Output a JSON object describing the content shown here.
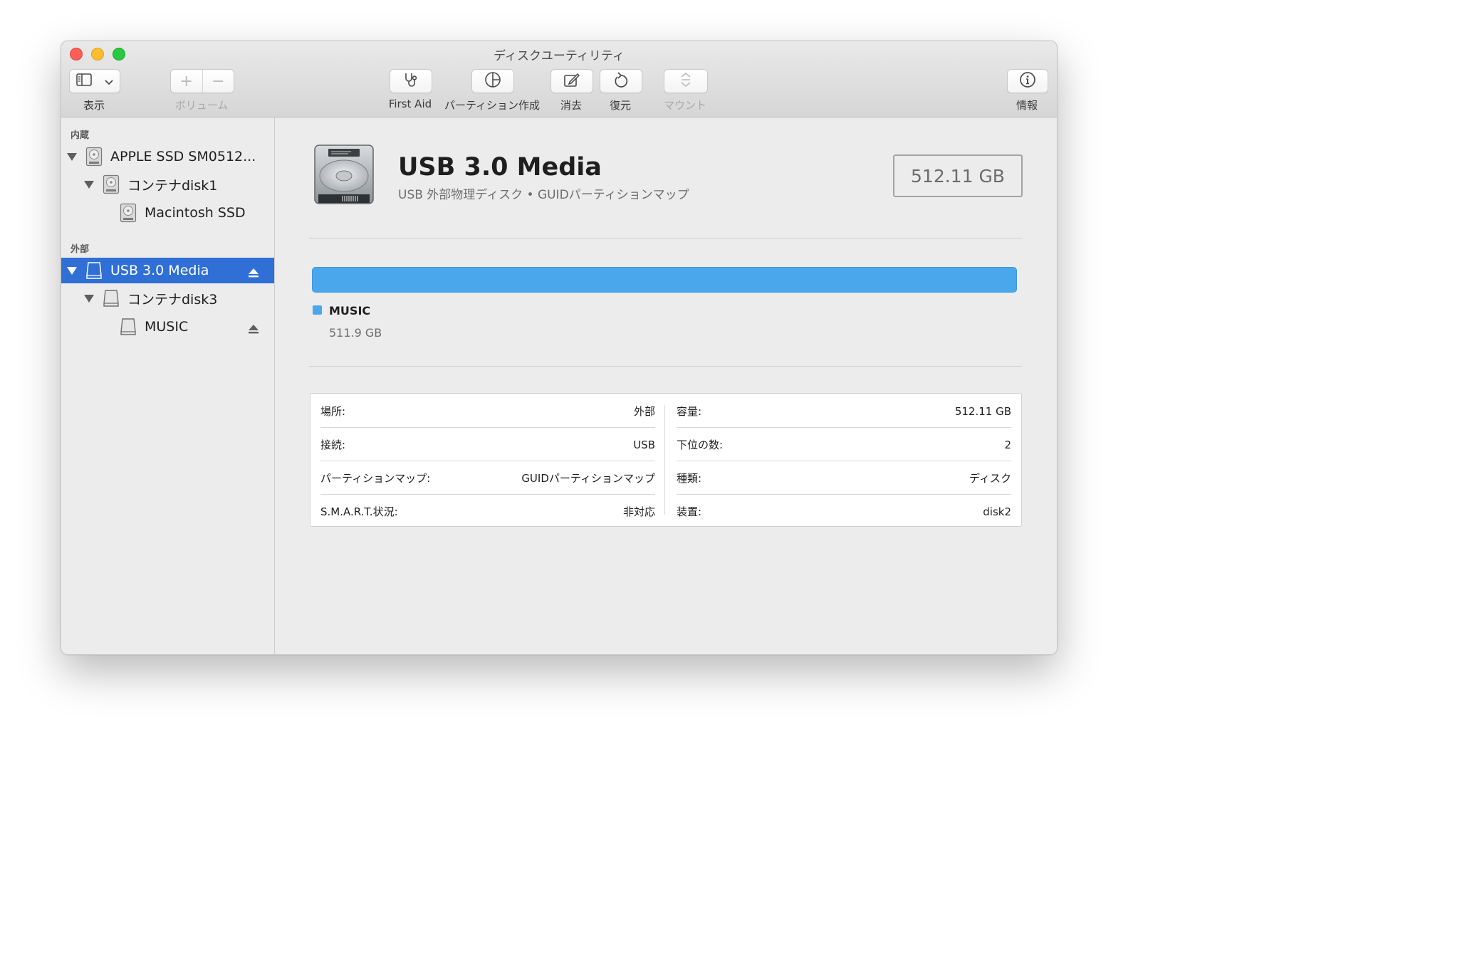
{
  "window": {
    "title": "ディスクユーティリティ"
  },
  "toolbar": {
    "view_label": "表示",
    "volume_label": "ボリューム",
    "volume_add": "+",
    "volume_remove": "−",
    "first_aid_label": "First Aid",
    "partition_label": "パーティション作成",
    "erase_label": "消去",
    "restore_label": "復元",
    "mount_label": "マウント",
    "info_label": "情報"
  },
  "sidebar": {
    "internal_header": "内蔵",
    "external_header": "外部",
    "items": [
      {
        "label": "APPLE SSD SM0512..."
      },
      {
        "label": "コンテナdisk1"
      },
      {
        "label": "Macintosh SSD"
      },
      {
        "label": "USB 3.0 Media"
      },
      {
        "label": "コンテナdisk3"
      },
      {
        "label": "MUSIC"
      }
    ]
  },
  "detail": {
    "title": "USB 3.0 Media",
    "subtitle": "USB 外部物理ディスク • GUIDパーティションマップ",
    "capacity": "512.11 GB",
    "usage": {
      "fill_fraction": 1.0,
      "color": "#4aa7ec"
    },
    "partition_name": "MUSIC",
    "partition_size": "511.9 GB"
  },
  "info": {
    "left": [
      {
        "key": "場所:",
        "value": "外部"
      },
      {
        "key": "接続:",
        "value": "USB"
      },
      {
        "key": "パーティションマップ:",
        "value": "GUIDパーティションマップ"
      },
      {
        "key": "S.M.A.R.T.状況:",
        "value": "非対応"
      }
    ],
    "right": [
      {
        "key": "容量:",
        "value": "512.11 GB"
      },
      {
        "key": "下位の数:",
        "value": "2"
      },
      {
        "key": "種類:",
        "value": "ディスク"
      },
      {
        "key": "装置:",
        "value": "disk2"
      }
    ]
  },
  "colors": {
    "selection": "#2f6fd6",
    "partition": "#4aa7ec",
    "close": "#fe5f57",
    "minimize": "#febc2e",
    "zoom": "#28c840"
  }
}
